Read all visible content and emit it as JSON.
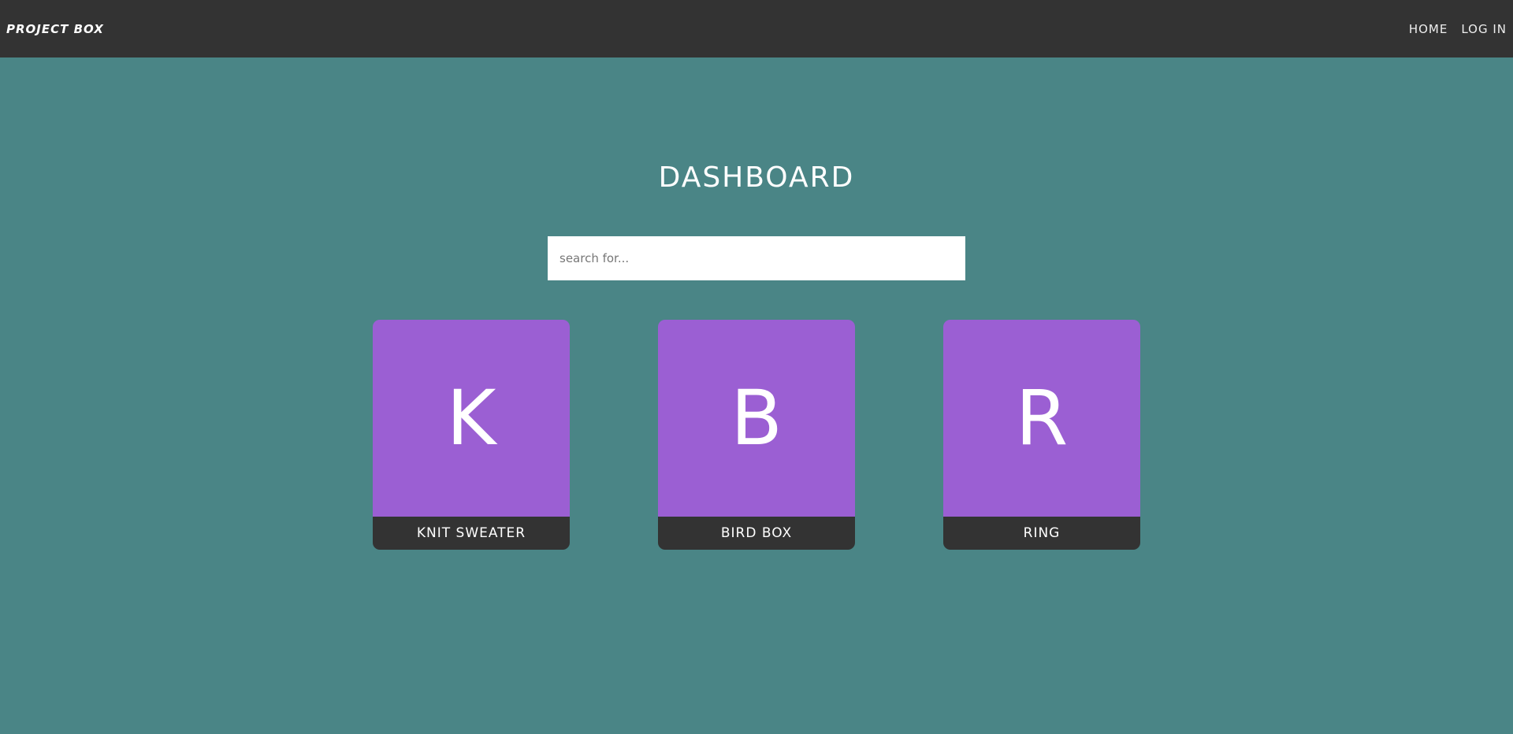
{
  "navbar": {
    "brand": "PROJECT BOX",
    "links": [
      "HOME",
      "LOG IN"
    ]
  },
  "main": {
    "title": "DASHBOARD",
    "search": {
      "placeholder": "search for...",
      "value": ""
    },
    "cards": [
      {
        "initial": "K",
        "label": "KNIT SWEATER"
      },
      {
        "initial": "B",
        "label": "BIRD BOX"
      },
      {
        "initial": "R",
        "label": "RING"
      }
    ]
  },
  "colors": {
    "background": "#4a8586",
    "navbar": "#333333",
    "card_accent": "#9b5fd3",
    "card_label_bg": "#333333"
  }
}
